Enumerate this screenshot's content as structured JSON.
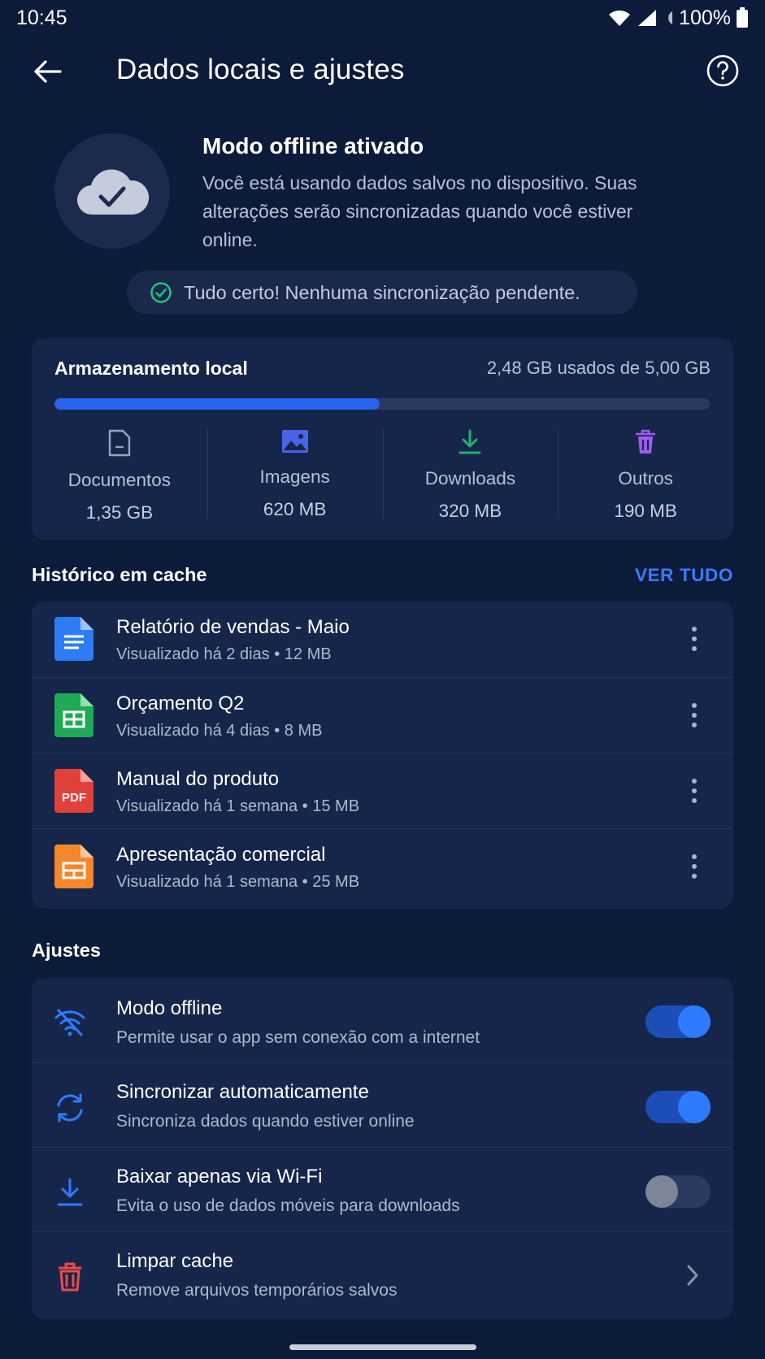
{
  "status_bar": {
    "time": "10:45",
    "battery": "100%"
  },
  "header": {
    "title": "Dados locais e ajustes"
  },
  "hero": {
    "title": "Modo offline ativado",
    "description": "Você está usando dados salvos no dispositivo. Suas alterações serão sincronizadas quando você estiver online."
  },
  "sync_status": "Tudo certo! Nenhuma sincronização pendente.",
  "storage": {
    "title": "Armazenamento local",
    "used_text": "2,48 GB usados de 5,00 GB",
    "used_fraction": 0.496,
    "categories": [
      {
        "label": "Documentos",
        "value": "1,35 GB",
        "icon": "document-icon",
        "color": "#9aa3b8"
      },
      {
        "label": "Imagens",
        "value": "620 MB",
        "icon": "image-icon",
        "color": "#4a63e8"
      },
      {
        "label": "Downloads",
        "value": "320 MB",
        "icon": "download-icon",
        "color": "#1fb36a"
      },
      {
        "label": "Outros",
        "value": "190 MB",
        "icon": "trash-icon",
        "color": "#a05cf0"
      }
    ]
  },
  "history": {
    "title": "Histórico em cache",
    "see_all": "VER TUDO",
    "items": [
      {
        "title": "Relatório de vendas - Maio",
        "subtitle": "Visualizado há 2 dias • 12 MB",
        "icon": "doc-file-icon",
        "color": "#2d7cf6"
      },
      {
        "title": "Orçamento Q2",
        "subtitle": "Visualizado há 4 dias • 8 MB",
        "icon": "sheet-file-icon",
        "color": "#1faa55"
      },
      {
        "title": "Manual do produto",
        "subtitle": "Visualizado há 1 semana • 15 MB",
        "icon": "pdf-file-icon",
        "color": "#e2413b",
        "badge": "PDF"
      },
      {
        "title": "Apresentação comercial",
        "subtitle": "Visualizado há 1 semana • 25 MB",
        "icon": "slides-file-icon",
        "color": "#f5862a"
      }
    ]
  },
  "settings": {
    "title": "Ajustes",
    "items": [
      {
        "title": "Modo offline",
        "subtitle": "Permite usar o app sem conexão com a internet",
        "icon": "wifi-off-icon",
        "control": "toggle",
        "on": true
      },
      {
        "title": "Sincronizar automaticamente",
        "subtitle": "Sincroniza dados quando estiver online",
        "icon": "sync-icon",
        "control": "toggle",
        "on": true
      },
      {
        "title": "Baixar apenas via Wi-Fi",
        "subtitle": "Evita o uso de dados móveis para downloads",
        "icon": "download-icon",
        "control": "toggle",
        "on": false
      },
      {
        "title": "Limpar cache",
        "subtitle": "Remove arquivos temporários salvos",
        "icon": "trash-icon",
        "control": "chevron"
      }
    ]
  },
  "colors": {
    "accent": "#2f7bff",
    "background": "#0d1b3a",
    "card": "#15264a",
    "success": "#1fc27a",
    "danger": "#ee4a4a"
  }
}
